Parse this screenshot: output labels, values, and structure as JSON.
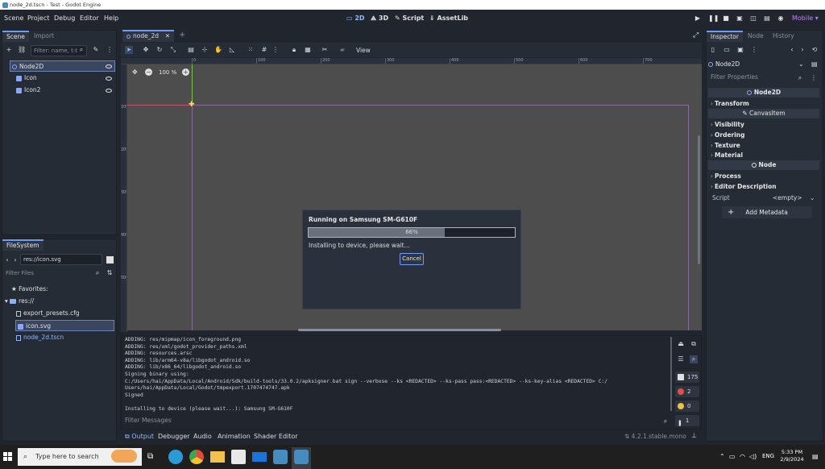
{
  "window": {
    "title": "node_2d.tscn - Test - Godot Engine"
  },
  "menu": {
    "items": [
      "Scene",
      "Project",
      "Debug",
      "Editor",
      "Help"
    ]
  },
  "workspaces": {
    "w2d": "2D",
    "w3d": "3D",
    "script": "Script",
    "assetlib": "AssetLib"
  },
  "renderer": "Mobile",
  "scene_dock": {
    "tabs": [
      "Scene",
      "Import"
    ],
    "filter_placeholder": "Filter: name, t:t",
    "tree": [
      {
        "label": "Node2D"
      },
      {
        "label": "Icon"
      },
      {
        "label": "Icon2"
      }
    ]
  },
  "filesystem": {
    "tab": "FileSystem",
    "path": "res://icon.svg",
    "filter_placeholder": "Filter Files",
    "favorites": "Favorites:",
    "root": "res://",
    "files": [
      "export_presets.cfg",
      "icon.svg",
      "node_2d.tscn"
    ]
  },
  "editor": {
    "scene_tab": "node_2d",
    "view_menu": "View",
    "zoom": "100 %",
    "ruler_labels": [
      "0",
      "100",
      "200",
      "300",
      "400",
      "500",
      "600",
      "700",
      "800",
      "900",
      "1000"
    ],
    "ruler_v_labels": [
      "100",
      "200",
      "300",
      "400",
      "500"
    ]
  },
  "export_dialog": {
    "title": "Running on Samsung SM-G610F",
    "progress": 0.66,
    "progress_text": "66%",
    "status": "Installing to device, please wait...",
    "cancel": "Cancel"
  },
  "output": {
    "lines": [
      "ADDING: res/mipmap/icon_foreground.png",
      "ADDING: res/xml/godot_provider_paths.xml",
      "ADDING: resources.arsc",
      "ADDING: lib/arm64-v8a/libgodot_android.so",
      "ADDING: lib/x86_64/libgodot_android.so",
      "Signing binary using:",
      "C:/Users/hai/AppData/Local/Android/Sdk/build-tools/33.0.2/apksigner.bat sign --verbose --ks <REDACTED> --ks-pass pass:<REDACTED> --ks-key-alias <REDACTED> C:/",
      "Users/hai/AppData/Local/Godot/tmpexport.1707474747.apk",
      "Signed",
      "",
      "Installing to device (please wait...): Samsung SM-G610F"
    ],
    "filter_placeholder": "Filter Messages",
    "counts": {
      "messages": "175",
      "errors": "2",
      "warnings": "0",
      "editor": "1"
    }
  },
  "bottom_tabs": [
    "Output",
    "Debugger",
    "Audio",
    "Animation",
    "Shader Editor"
  ],
  "version": "4.2.1.stable.mono",
  "inspector": {
    "tabs": [
      "Inspector",
      "Node",
      "History"
    ],
    "node_name": "Node2D",
    "filter_placeholder": "Filter Properties",
    "sections": {
      "node2d": "Node2D",
      "transform": "Transform",
      "canvasitem": "CanvasItem",
      "visibility": "Visibility",
      "ordering": "Ordering",
      "texture": "Texture",
      "material": "Material",
      "node": "Node",
      "process": "Process",
      "editor_description": "Editor Description",
      "script_label": "Script",
      "script_value": "<empty>",
      "add_metadata": "Add Metadata"
    }
  },
  "taskbar": {
    "search_placeholder": "Type here to search",
    "lang": "ENG",
    "time": "5:33 PM",
    "date": "2/9/2024"
  },
  "colors": {
    "accent": "#6a9df8",
    "selection": "#3a4660",
    "renderer": "#c77dff",
    "x_axis": "#c8526b",
    "y_axis": "#7fbf4d"
  }
}
